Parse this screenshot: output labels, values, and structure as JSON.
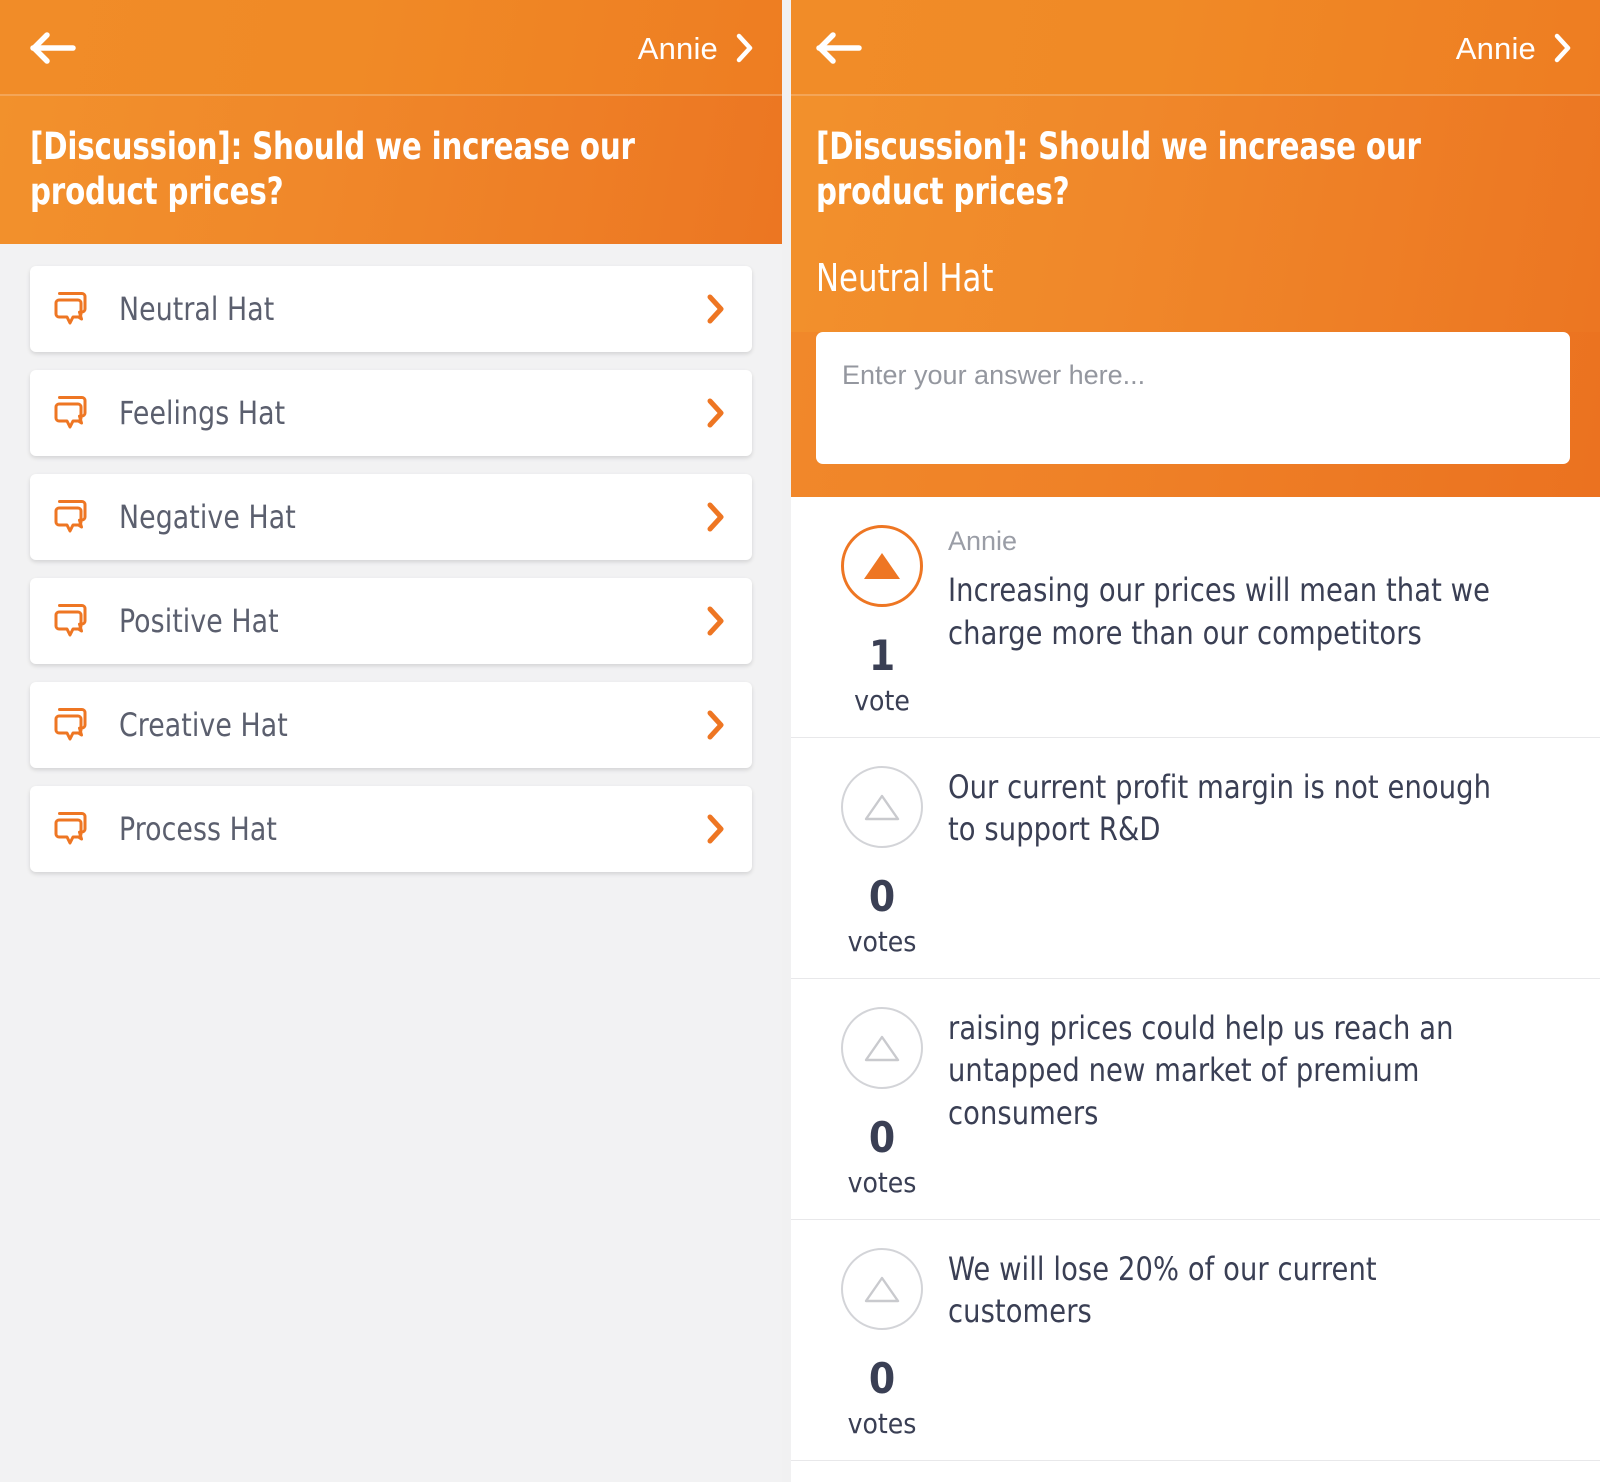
{
  "theme": {
    "accent": "#ee7623",
    "accent_light": "#f2912c",
    "panel_bg": "#f2f2f3",
    "text_dark": "#3a3f54",
    "text_muted": "#9a9da6",
    "card_bg": "#ffffff"
  },
  "left_panel": {
    "topbar": {
      "back_icon": "back-arrow-icon",
      "user_label": "Annie",
      "chevron_icon": "chevron-right-icon"
    },
    "discussion_title": "[Discussion]: Should we increase our product prices?",
    "hats": [
      {
        "label": "Neutral Hat",
        "icon": "chat-bubbles-icon",
        "chevron": "chevron-right-icon"
      },
      {
        "label": "Feelings Hat",
        "icon": "chat-bubbles-icon",
        "chevron": "chevron-right-icon"
      },
      {
        "label": "Negative Hat",
        "icon": "chat-bubbles-icon",
        "chevron": "chevron-right-icon"
      },
      {
        "label": "Positive Hat",
        "icon": "chat-bubbles-icon",
        "chevron": "chevron-right-icon"
      },
      {
        "label": "Creative Hat",
        "icon": "chat-bubbles-icon",
        "chevron": "chevron-right-icon"
      },
      {
        "label": "Process Hat",
        "icon": "chat-bubbles-icon",
        "chevron": "chevron-right-icon"
      }
    ]
  },
  "right_panel": {
    "topbar": {
      "back_icon": "back-arrow-icon",
      "user_label": "Annie",
      "chevron_icon": "chevron-right-icon"
    },
    "discussion_title": "[Discussion]: Should we increase our product prices?",
    "hat_title": "Neutral Hat",
    "answer_input": {
      "placeholder": "Enter your answer here...",
      "value": ""
    },
    "answers": [
      {
        "author": "Annie",
        "text": "Increasing our prices will mean that we charge more than our competitors",
        "votes": "1",
        "votes_word": "vote",
        "voted": true,
        "vote_icon": "triangle-up-icon"
      },
      {
        "author": "",
        "text": "Our current profit margin is not enough to support R&D",
        "votes": "0",
        "votes_word": "votes",
        "voted": false,
        "vote_icon": "triangle-up-icon"
      },
      {
        "author": "",
        "text": "raising prices could help us reach an untapped new market of premium consumers",
        "votes": "0",
        "votes_word": "votes",
        "voted": false,
        "vote_icon": "triangle-up-icon"
      },
      {
        "author": "",
        "text": "We will lose 20% of our current customers",
        "votes": "0",
        "votes_word": "votes",
        "voted": false,
        "vote_icon": "triangle-up-icon"
      }
    ]
  }
}
